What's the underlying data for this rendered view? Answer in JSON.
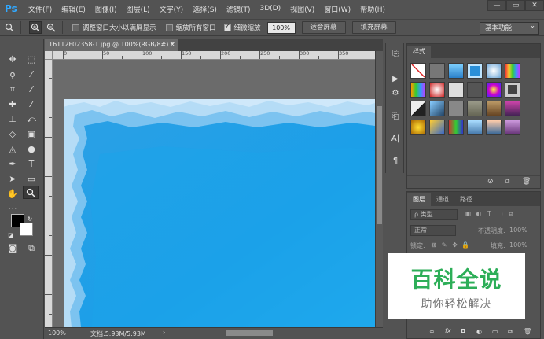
{
  "app": {
    "logo": "Ps"
  },
  "menu": [
    "文件(F)",
    "编辑(E)",
    "图像(I)",
    "图层(L)",
    "文字(Y)",
    "选择(S)",
    "滤镜(T)",
    "3D(D)",
    "视图(V)",
    "窗口(W)",
    "帮助(H)"
  ],
  "window_controls": {
    "minimize": "—",
    "restore": "▭",
    "close": "✕"
  },
  "options": {
    "chk_resize": {
      "label": "调整窗口大小以满屏显示",
      "checked": false
    },
    "chk_zoom_all": {
      "label": "缩放所有窗口",
      "checked": false
    },
    "chk_scrubby": {
      "label": "细微缩放",
      "checked": true
    },
    "zoom_value": "100%",
    "fit_screen": "适合屏幕",
    "fill_screen": "填充屏幕",
    "workspace": "基本功能"
  },
  "document": {
    "tab_title": "16112F02358-1.jpg @ 100%(RGB/8#) *",
    "tab_close": "×",
    "ruler_numbers": [
      "0",
      "50",
      "100",
      "150",
      "200",
      "250",
      "300",
      "350"
    ],
    "zoom": "100%",
    "doc_size": "文档:5.93M/5.93M"
  },
  "styles_panel": {
    "tab": "样式"
  },
  "layers_panel": {
    "tabs": [
      "图层",
      "通道",
      "路径"
    ],
    "filter_kind": "ρ 类型",
    "blend_mode": "正常",
    "opacity_label": "不透明度:",
    "opacity_value": "100%",
    "lock_label": "锁定:",
    "fill_label": "填充:",
    "fill_value": "100%"
  },
  "watermark": {
    "title": "百科全说",
    "subtitle": "助你轻松解决"
  },
  "colors": {
    "ui_bg": "#535353",
    "canvas_blue": "#1ba3e8",
    "watermark_green": "#2dae58"
  }
}
